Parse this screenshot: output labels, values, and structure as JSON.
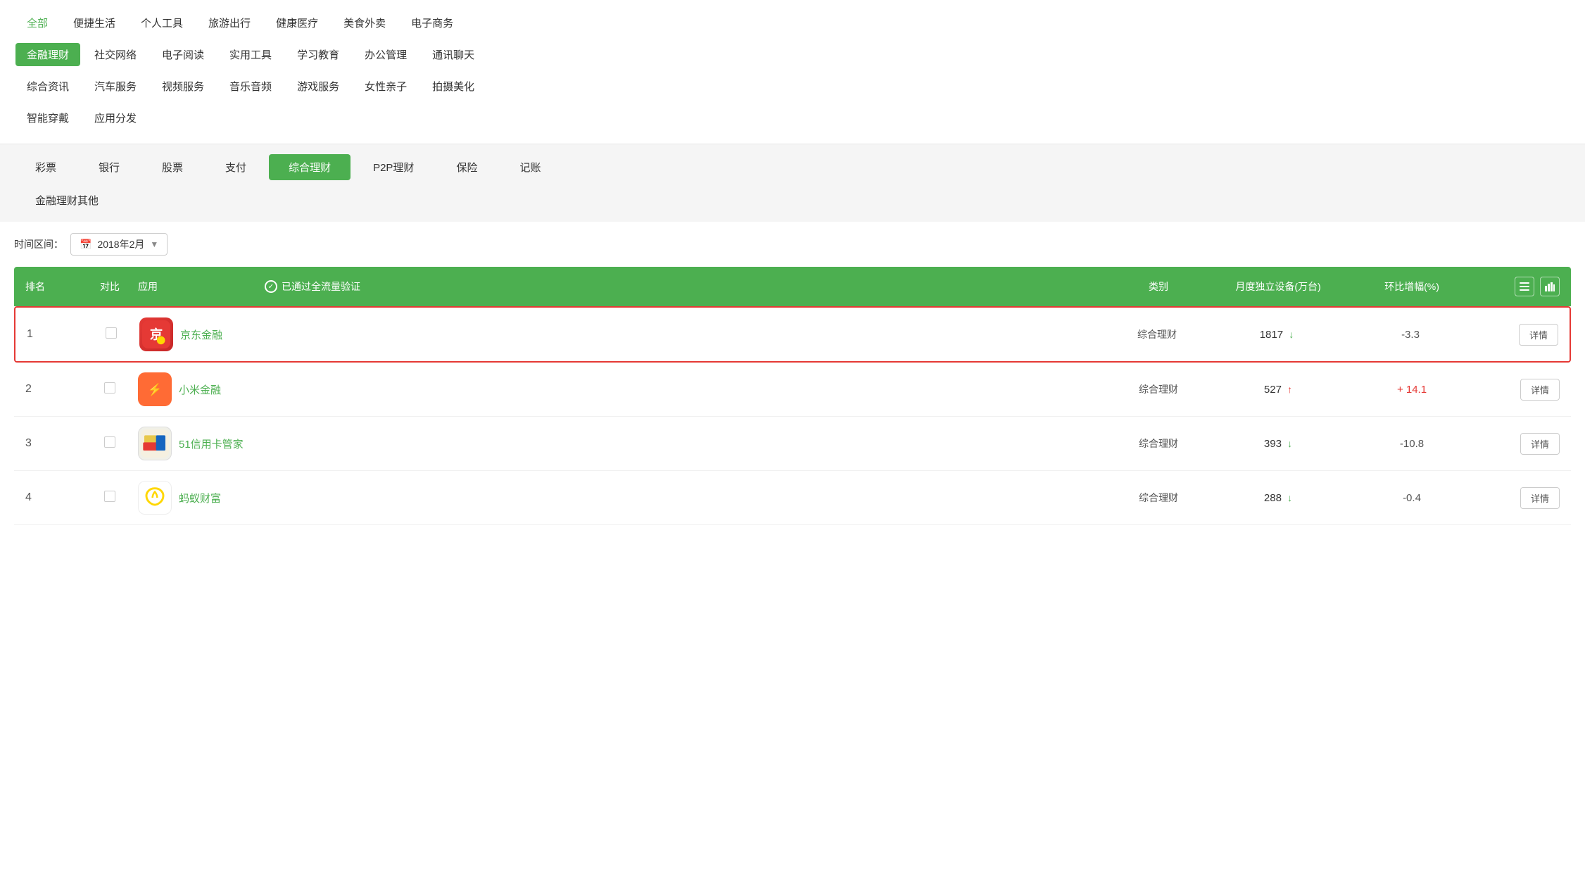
{
  "topNav": {
    "rows": [
      [
        "全部",
        "便捷生活",
        "个人工具",
        "旅游出行",
        "健康医疗",
        "美食外卖",
        "电子商务"
      ],
      [
        "金融理财",
        "社交网络",
        "电子阅读",
        "实用工具",
        "学习教育",
        "办公管理",
        "通讯聊天"
      ],
      [
        "综合资讯",
        "汽车服务",
        "视频服务",
        "音乐音频",
        "游戏服务",
        "女性亲子",
        "拍摄美化"
      ],
      [
        "智能穿戴",
        "应用分发"
      ]
    ],
    "activeItem": "金融理财",
    "allItem": "全部"
  },
  "subNav": {
    "items": [
      "彩票",
      "银行",
      "股票",
      "支付",
      "综合理财",
      "P2P理财",
      "保险",
      "记账",
      "金融理财其他"
    ],
    "activeItem": "综合理财"
  },
  "timeSelector": {
    "label": "时间区间：",
    "value": "2018年2月",
    "calendarIcon": "📅"
  },
  "table": {
    "headers": {
      "rank": "排名",
      "compare": "对比",
      "app": "应用",
      "verified": "已通过全流量验证",
      "category": "类别",
      "devices": "月度独立设备(万台)",
      "growth": "环比增幅(%)",
      "listIcon": "≡",
      "chartIcon": "📊"
    },
    "rows": [
      {
        "rank": 1,
        "appName": "京东金融",
        "category": "综合理财",
        "devices": "1817",
        "deviceTrend": "down",
        "growth": "-3.3",
        "growthSign": "negative",
        "highlighted": true,
        "detailLabel": "详情",
        "iconType": "jd"
      },
      {
        "rank": 2,
        "appName": "小米金融",
        "category": "综合理财",
        "devices": "527",
        "deviceTrend": "up",
        "growth": "+ 14.1",
        "growthSign": "positive",
        "highlighted": false,
        "detailLabel": "详情",
        "iconType": "xiaomi"
      },
      {
        "rank": 3,
        "appName": "51信用卡管家",
        "category": "综合理财",
        "devices": "393",
        "deviceTrend": "down",
        "growth": "-10.8",
        "growthSign": "negative",
        "highlighted": false,
        "detailLabel": "详情",
        "iconType": "51"
      },
      {
        "rank": 4,
        "appName": "蚂蚁财富",
        "category": "综合理财",
        "devices": "288",
        "deviceTrend": "down",
        "growth": "-0.4",
        "growthSign": "negative",
        "highlighted": false,
        "detailLabel": "详情",
        "iconType": "ant"
      }
    ]
  }
}
